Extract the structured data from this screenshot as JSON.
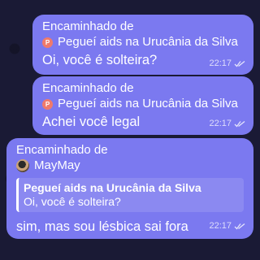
{
  "messages": [
    {
      "forward_header": "Encaminhado de",
      "sender": "Pegueí aids na Urucânia da Silva",
      "avatar_letter": "P",
      "text": "Oi, você é solteira?",
      "time": "22:17"
    },
    {
      "forward_header": "Encaminhado de",
      "sender": "Pegueí aids na Urucânia da Silva",
      "avatar_letter": "P",
      "text": "Achei você legal",
      "time": "22:17"
    },
    {
      "forward_header": "Encaminhado de",
      "sender": "MayMay",
      "quote_title": "Pegueí aids na Urucânia da Silva",
      "quote_text": "Oi, você é solteira?",
      "text": "sim, mas sou lésbica sai fora",
      "time": "22:17"
    }
  ],
  "colors": {
    "bubble": "#7b79f0",
    "background": "#1a1a35",
    "avatar_p": "#f07a6b"
  },
  "icons": {
    "read_receipt": "double-check-icon",
    "sender_avatar": "p-avatar-icon"
  }
}
